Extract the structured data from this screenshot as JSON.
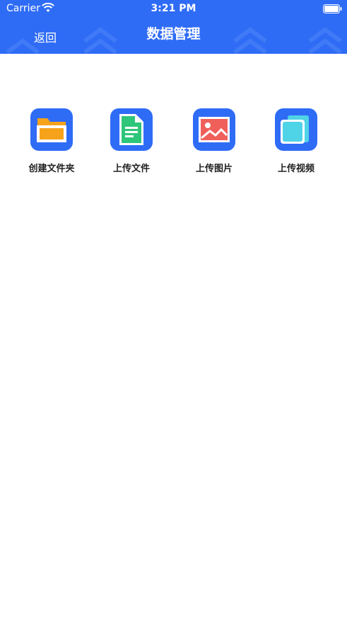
{
  "status_bar": {
    "carrier": "Carrier",
    "time": "3:21 PM"
  },
  "nav": {
    "back_label": "返回",
    "title": "数据管理"
  },
  "actions": [
    {
      "label": "创建文件夹",
      "icon": "folder-icon",
      "color": "#f7a21b"
    },
    {
      "label": "上传文件",
      "icon": "document-icon",
      "color": "#2ec67a"
    },
    {
      "label": "上传图片",
      "icon": "image-icon",
      "color": "#f0605a"
    },
    {
      "label": "上传视频",
      "icon": "video-icon",
      "color": "#4fd3e6"
    }
  ],
  "colors": {
    "primary": "#2f6cf6",
    "background": "#ffffff"
  }
}
